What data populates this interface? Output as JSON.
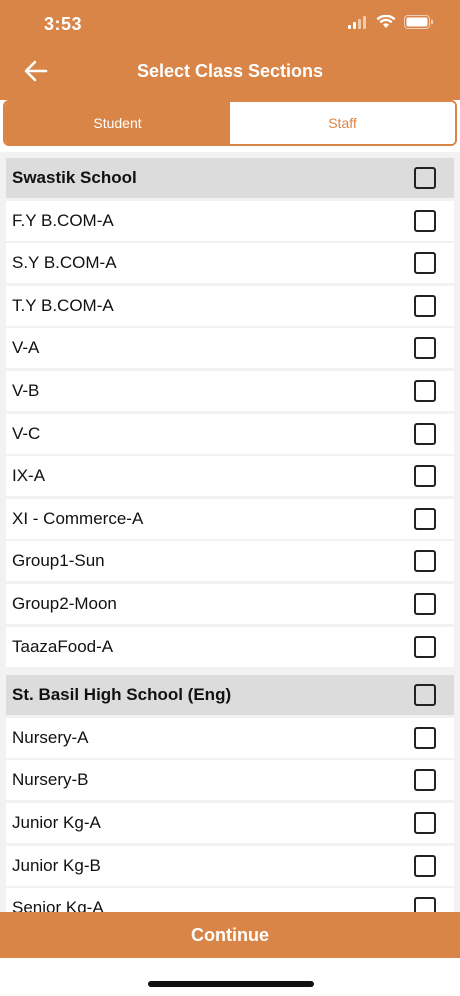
{
  "status_bar": {
    "time": "3:53"
  },
  "nav": {
    "title": "Select Class Sections"
  },
  "tabs": [
    {
      "label": "Student",
      "active": true
    },
    {
      "label": "Staff",
      "active": false
    }
  ],
  "schools": [
    {
      "name": "Swastik School",
      "sections": [
        "F.Y B.COM-A",
        "S.Y B.COM-A",
        "T.Y B.COM-A",
        "V-A",
        "V-B",
        "V-C",
        "IX-A",
        "XI - Commerce-A",
        "Group1-Sun",
        "Group2-Moon",
        "TaazaFood-A"
      ]
    },
    {
      "name": "St. Basil High School (Eng)",
      "sections": [
        "Nursery-A",
        "Nursery-B",
        "Junior Kg-A",
        "Junior Kg-B",
        "Senior Kg-A"
      ]
    }
  ],
  "footer": {
    "continue_label": "Continue"
  },
  "colors": {
    "accent": "#D98548",
    "header_bg": "#dcdcdc",
    "list_bg": "#f2f2f2"
  },
  "icons": {
    "back": "arrow-left-icon",
    "signal": "signal-icon",
    "wifi": "wifi-icon",
    "battery": "battery-icon"
  }
}
